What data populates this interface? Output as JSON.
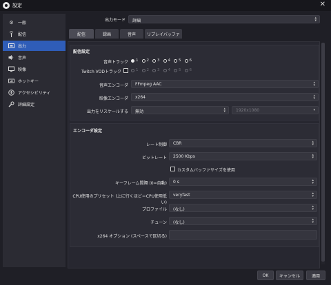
{
  "window": {
    "title": "設定",
    "close_glyph": "✕"
  },
  "sidebar": {
    "items": [
      {
        "label": "一般",
        "icon": "gear-icon",
        "glyph": "⚙",
        "active": false
      },
      {
        "label": "配信",
        "icon": "antenna-icon",
        "glyph": "📡",
        "active": false
      },
      {
        "label": "出力",
        "icon": "output-icon",
        "glyph": "▭",
        "active": true
      },
      {
        "label": "音声",
        "icon": "speaker-icon",
        "glyph": "🔊",
        "active": false
      },
      {
        "label": "映像",
        "icon": "monitor-icon",
        "glyph": "▭",
        "active": false
      },
      {
        "label": "ホットキー",
        "icon": "keyboard-icon",
        "glyph": "⌨",
        "active": false
      },
      {
        "label": "アクセシビリティ",
        "icon": "accessibility-icon",
        "glyph": "◉",
        "active": false
      },
      {
        "label": "詳細設定",
        "icon": "wrench-icon",
        "glyph": "🔧",
        "active": false
      }
    ]
  },
  "output_mode": {
    "label": "出力モード",
    "value": "詳細"
  },
  "tabs": [
    {
      "label": "配信",
      "active": true
    },
    {
      "label": "録画",
      "active": false
    },
    {
      "label": "音声",
      "active": false
    },
    {
      "label": "リプレイバッファ",
      "active": false
    }
  ],
  "stream_settings": {
    "title": "配信設定",
    "audio_track_label": "音声トラック",
    "audio_tracks": [
      "1",
      "2",
      "3",
      "4",
      "5",
      "6"
    ],
    "audio_track_selected": "1",
    "twitch_vod_label": "Twitch VODトラック",
    "twitch_vod_tracks": [
      "1",
      "2",
      "3",
      "4",
      "5",
      "6"
    ],
    "audio_encoder_label": "音声エンコーダ",
    "audio_encoder_value": "FFmpeg AAC",
    "video_encoder_label": "映像エンコーダ",
    "video_encoder_value": "x264",
    "rescale_label": "出力をリスケールする",
    "rescale_value": "無効",
    "rescale_resolution": "1920x1080"
  },
  "encoder_settings": {
    "title": "エンコーダ設定",
    "rate_control_label": "レート制御",
    "rate_control_value": "CBR",
    "bitrate_label": "ビットレート",
    "bitrate_value": "2500 Kbps",
    "custom_buffer_label": "カスタムバッファサイズを使用",
    "keyframe_label": "キーフレーム間隔 (0=自動)",
    "keyframe_value": "0 s",
    "cpu_preset_label": "CPU使用のプリセット (上に行くほど＝CPU使用低い)",
    "cpu_preset_value": "veryfast",
    "profile_label": "プロファイル",
    "profile_value": "(なし)",
    "tune_label": "チューン",
    "tune_value": "(なし)",
    "x264_options_label": "x264 オプション (スペースで区切る)",
    "x264_options_value": ""
  },
  "buttons": {
    "ok": "OK",
    "cancel": "キャンセル",
    "apply": "適用"
  }
}
